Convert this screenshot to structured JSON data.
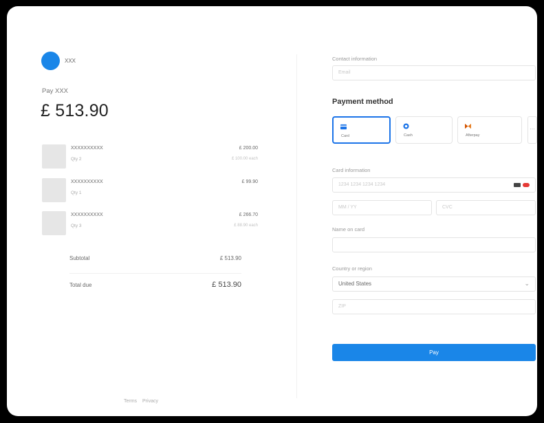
{
  "merchant": {
    "name": "XXX"
  },
  "summary": {
    "pay_label": "Pay XXX",
    "amount": "£ 513.90",
    "items": [
      {
        "name": "XXXXXXXXXX",
        "qty": "Qty 2",
        "price": "£ 200.00",
        "each": "£ 100.00 each"
      },
      {
        "name": "XXXXXXXXXX",
        "qty": "Qty 1",
        "price": "£ 99.90",
        "each": ""
      },
      {
        "name": "XXXXXXXXXX",
        "qty": "Qty 3",
        "price": "£ 266.70",
        "each": "£ 88.90 each"
      }
    ],
    "subtotal_label": "Subtotal",
    "subtotal_value": "£ 513.90",
    "total_label": "Total due",
    "total_value": "£ 513.90"
  },
  "footer": {
    "terms": "Terms",
    "privacy": "Privacy"
  },
  "form": {
    "contact_label": "Contact information",
    "email_placeholder": "Email",
    "payment_method_title": "Payment method",
    "methods": [
      {
        "label": "Card",
        "icon": "card-icon",
        "color": "#1a73e8"
      },
      {
        "label": "Cash",
        "icon": "cash-icon",
        "color": "#1a73e8"
      },
      {
        "label": "Afterpay",
        "icon": "afterpay-icon",
        "color": "#d35400"
      }
    ],
    "card_info_label": "Card information",
    "card_number_placeholder": "1234 1234 1234 1234",
    "expiry_placeholder": "MM / YY",
    "cvc_placeholder": "CVC",
    "name_label": "Name on card",
    "name_value": "",
    "country_label": "Country or region",
    "country_value": "United States",
    "zip_placeholder": "ZIP",
    "pay_button": "Pay"
  },
  "colors": {
    "accent": "#1a86e8",
    "background": "#000000",
    "card": "#ffffff"
  }
}
